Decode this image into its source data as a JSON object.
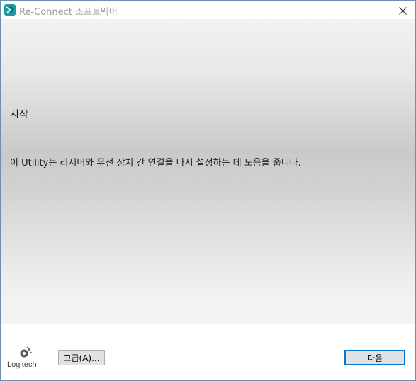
{
  "window": {
    "title": "Re-Connect 소프트웨어",
    "icon": "logitech-unifying-icon",
    "accent_color": "#0078d7",
    "icon_color": "#1b9aa0"
  },
  "content": {
    "heading": "시작",
    "description": "이 Utility는 리시버와 무선 장치 간 연결을 다시 설정하는 데 도움을 줍니다."
  },
  "footer": {
    "logo_text": "Logitech",
    "advanced_button": "고급(A)...",
    "next_button": "다음"
  }
}
